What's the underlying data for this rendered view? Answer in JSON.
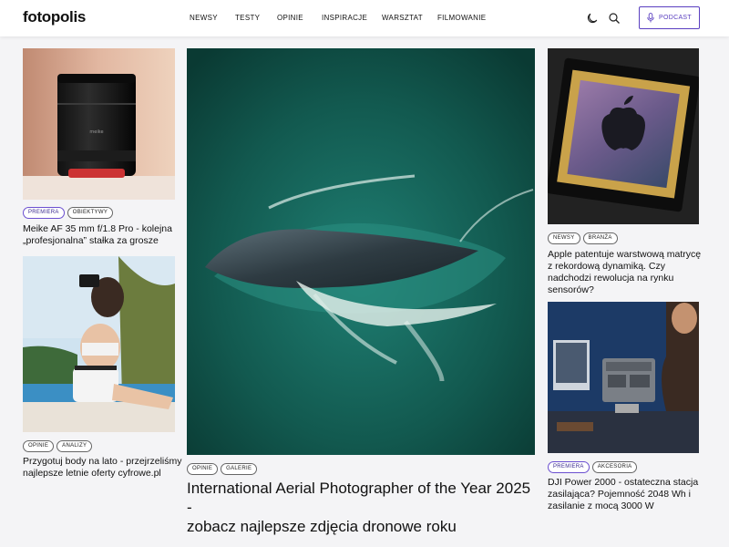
{
  "header": {
    "logo": "fotopolis",
    "nav": [
      "NEWSY",
      "TESTY",
      "OPINIE",
      "INSPIRACJE",
      "WARSZTAT",
      "FILMOWANIE"
    ],
    "podcast_label": "PODCAST",
    "accent": "#5a3fc0"
  },
  "cards": {
    "lens": {
      "tags": [
        "PREMIERA",
        "OBIEKTYWY"
      ],
      "title_line1": "Meike AF 35 mm f/1.8 Pro - kolejna",
      "title_line2": "„profesjonalna” stałka za grosze"
    },
    "woman": {
      "tags": [
        "OPINIE",
        "ANALIZY"
      ],
      "title_line1": "Przygotuj body na lato - przejrzeliśmy",
      "title_line2": "najlepsze letnie oferty cyfrowe.pl"
    },
    "whale": {
      "tags": [
        "OPINIE",
        "GALERIE"
      ],
      "title_line1": "International Aerial Photographer of the Year 2025 -",
      "title_line2": "zobacz najlepsze zdjęcia dronowe roku"
    },
    "sensor": {
      "tags": [
        "NEWSY",
        "BRANŻA"
      ],
      "title_line1": "Apple patentuje warstwową matrycę",
      "title_line2": "z rekordową dynamiką. Czy",
      "title_line3": "nadchodzi rewolucja na rynku",
      "title_line4": "sensorów?"
    },
    "power": {
      "tags": [
        "PREMIERA",
        "AKCESORIA"
      ],
      "title_line1": "DJI Power 2000 - ostateczna stacja",
      "title_line2": "zasilająca? Pojemność 2048 Wh i",
      "title_line3": "zasilanie z mocą 3000 W"
    }
  }
}
